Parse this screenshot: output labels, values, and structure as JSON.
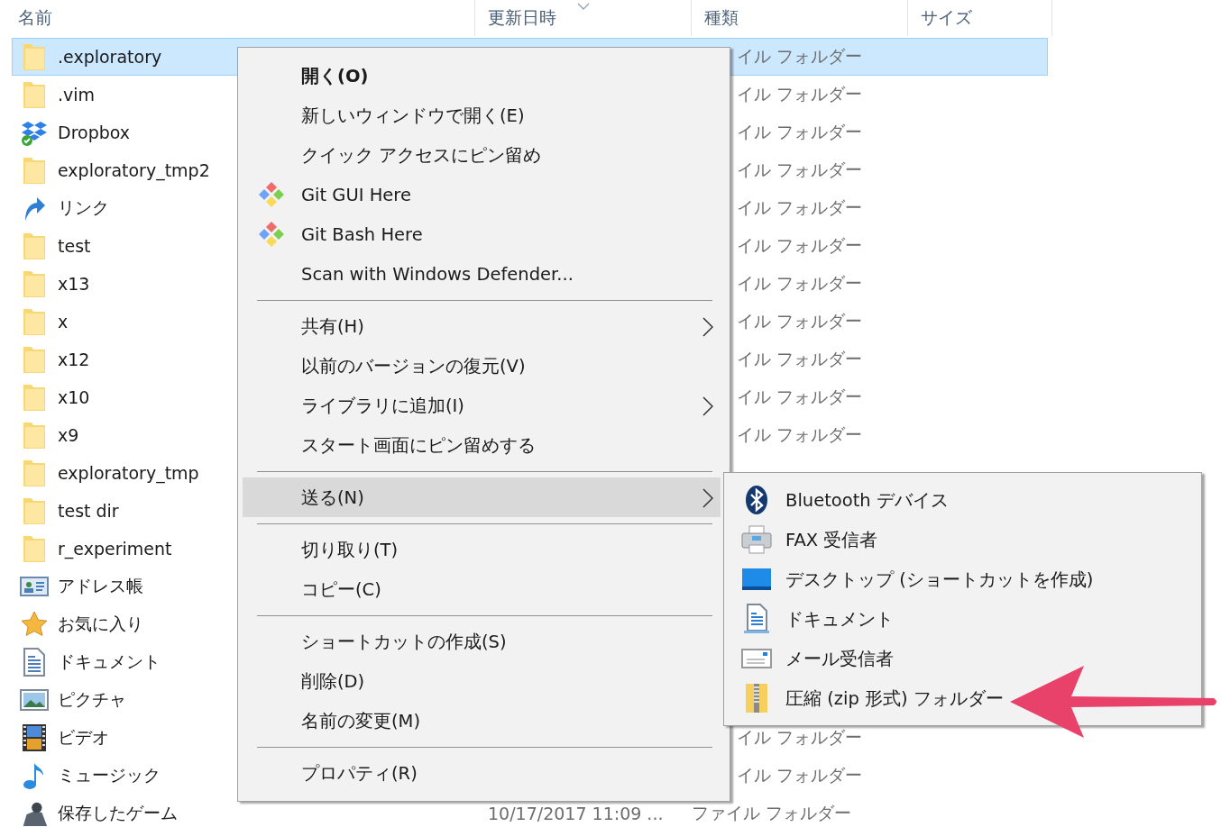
{
  "columns": [
    "名前",
    "更新日時",
    "種類",
    "サイズ"
  ],
  "files": [
    {
      "name": ".exploratory",
      "kind": "folder",
      "selected": true,
      "type": "イル フォルダー"
    },
    {
      "name": ".vim",
      "kind": "folder",
      "selected": false,
      "type": "イル フォルダー"
    },
    {
      "name": "Dropbox",
      "kind": "dropbox",
      "selected": false,
      "type": "イル フォルダー"
    },
    {
      "name": "exploratory_tmp2",
      "kind": "folder",
      "selected": false,
      "type": "イル フォルダー"
    },
    {
      "name": "リンク",
      "kind": "link",
      "selected": false,
      "type": "イル フォルダー"
    },
    {
      "name": "test",
      "kind": "folder",
      "selected": false,
      "type": "イル フォルダー"
    },
    {
      "name": "x13",
      "kind": "folder",
      "selected": false,
      "type": "イル フォルダー"
    },
    {
      "name": "x",
      "kind": "folder",
      "selected": false,
      "type": "イル フォルダー"
    },
    {
      "name": "x12",
      "kind": "folder",
      "selected": false,
      "type": "イル フォルダー"
    },
    {
      "name": "x10",
      "kind": "folder",
      "selected": false,
      "type": "イル フォルダー"
    },
    {
      "name": "x9",
      "kind": "folder",
      "selected": false,
      "type": "イル フォルダー"
    },
    {
      "name": "exploratory_tmp",
      "kind": "folder",
      "selected": false
    },
    {
      "name": "test dir",
      "kind": "folder",
      "selected": false
    },
    {
      "name": "r_experiment",
      "kind": "folder",
      "selected": false
    },
    {
      "name": "アドレス帳",
      "kind": "contacts",
      "selected": false
    },
    {
      "name": "お気に入り",
      "kind": "favorites",
      "selected": false
    },
    {
      "name": "ドキュメント",
      "kind": "documents",
      "selected": false
    },
    {
      "name": "ピクチャ",
      "kind": "pictures",
      "selected": false
    },
    {
      "name": "ビデオ",
      "kind": "videos",
      "selected": false,
      "type": "イル フォルダー"
    },
    {
      "name": "ミュージック",
      "kind": "music",
      "selected": false,
      "type": "イル フォルダー"
    },
    {
      "name": "保存したゲーム",
      "kind": "games",
      "selected": false,
      "modified": "10/17/2017 11:09 ...",
      "type": "ファイル フォルダー"
    }
  ],
  "context_menu": [
    {
      "kind": "plain",
      "label": "開く(O)",
      "default": true,
      "selected": false,
      "has_submenu": false
    },
    {
      "kind": "plain",
      "label": "新しいウィンドウで開く(E)",
      "default": false,
      "selected": false,
      "has_submenu": false
    },
    {
      "kind": "plain",
      "label": "クイック アクセスにピン留め",
      "default": false,
      "selected": false,
      "has_submenu": false
    },
    {
      "kind": "git",
      "label": "Git GUI Here",
      "default": false,
      "selected": false,
      "has_submenu": false
    },
    {
      "kind": "git",
      "label": "Git Bash Here",
      "default": false,
      "selected": false,
      "has_submenu": false
    },
    {
      "kind": "plain",
      "label": "Scan with Windows Defender...",
      "default": false,
      "selected": false,
      "has_submenu": false
    },
    {
      "kind": "separator"
    },
    {
      "kind": "plain",
      "label": "共有(H)",
      "default": false,
      "selected": false,
      "has_submenu": true
    },
    {
      "kind": "plain",
      "label": "以前のバージョンの復元(V)",
      "default": false,
      "selected": false,
      "has_submenu": false
    },
    {
      "kind": "plain",
      "label": "ライブラリに追加(I)",
      "default": false,
      "selected": false,
      "has_submenu": true
    },
    {
      "kind": "plain",
      "label": "スタート画面にピン留めする",
      "default": false,
      "selected": false,
      "has_submenu": false
    },
    {
      "kind": "separator"
    },
    {
      "kind": "plain",
      "label": "送る(N)",
      "default": false,
      "selected": true,
      "has_submenu": true,
      "submenu": [
        {
          "kind": "bluetooth",
          "label": "Bluetooth デバイス"
        },
        {
          "kind": "fax",
          "label": "FAX 受信者"
        },
        {
          "kind": "desktop",
          "label": "デスクトップ (ショートカットを作成)"
        },
        {
          "kind": "document",
          "label": "ドキュメント"
        },
        {
          "kind": "mail",
          "label": "メール受信者"
        },
        {
          "kind": "zip",
          "label": "圧縮 (zip 形式) フォルダー"
        }
      ]
    },
    {
      "kind": "separator"
    },
    {
      "kind": "plain",
      "label": "切り取り(T)",
      "default": false,
      "selected": false,
      "has_submenu": false
    },
    {
      "kind": "plain",
      "label": "コピー(C)",
      "default": false,
      "selected": false,
      "has_submenu": false
    },
    {
      "kind": "separator"
    },
    {
      "kind": "plain",
      "label": "ショートカットの作成(S)",
      "default": false,
      "selected": false,
      "has_submenu": false
    },
    {
      "kind": "plain",
      "label": "削除(D)",
      "default": false,
      "selected": false,
      "has_submenu": false
    },
    {
      "kind": "plain",
      "label": "名前の変更(M)",
      "default": false,
      "selected": false,
      "has_submenu": false
    },
    {
      "kind": "separator"
    },
    {
      "kind": "plain",
      "label": "プロパティ(R)",
      "default": false,
      "selected": false,
      "has_submenu": false
    }
  ]
}
